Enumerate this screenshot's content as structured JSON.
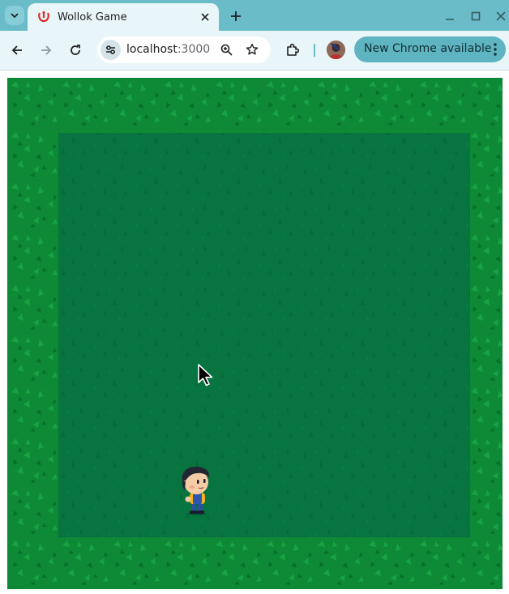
{
  "browser": {
    "tab": {
      "title": "Wollok Game"
    },
    "address": {
      "host": "localhost",
      "port": ":3000"
    },
    "update_chip": {
      "label": "New Chrome available"
    }
  },
  "icons": {
    "tab_search": "chevron-down-icon",
    "favicon": "wollok-logo-icon",
    "tab_close": "close-icon",
    "new_tab": "plus-icon",
    "minimize": "minimize-icon",
    "maximize": "maximize-icon",
    "close_window": "close-icon",
    "back": "arrow-left-icon",
    "forward": "arrow-right-icon",
    "reload": "reload-icon",
    "site_info": "tune-icon",
    "zoom": "zoom-icon",
    "bookmark": "star-icon",
    "extensions": "puzzle-icon",
    "menu": "more-vert-icon",
    "cursor": "arrow-pointer-icon"
  },
  "colors": {
    "frame": "#6bbcc9",
    "toolbar": "#e9f6f9",
    "grass_border": "#0e8a36",
    "grass_inner": "#087440",
    "update_chip": "#5fb4c2"
  },
  "game": {
    "grid_columns": 10,
    "grid_rows": 10,
    "player_cell": {
      "col": 3,
      "row": 3
    },
    "cursor_cell": {
      "col": 3,
      "row": 6
    }
  }
}
